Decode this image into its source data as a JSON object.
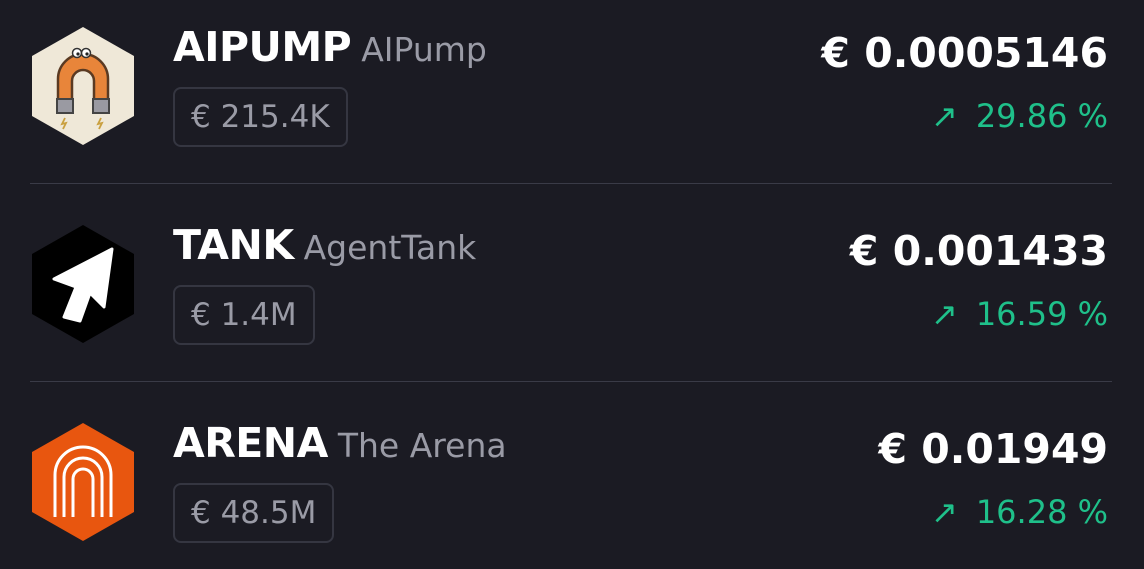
{
  "currency_symbol": "€",
  "colors": {
    "background": "#1b1b23",
    "positive": "#1fc08a",
    "muted_text": "#9a9ba6"
  },
  "tokens": [
    {
      "symbol": "AIPUMP",
      "name": "AIPump",
      "market_cap": "€ 215.4K",
      "price": "€ 0.0005146",
      "change_arrow": "↗",
      "change": "29.86 %",
      "icon": "aipump-magnet-logo-icon"
    },
    {
      "symbol": "TANK",
      "name": "AgentTank",
      "market_cap": "€ 1.4M",
      "price": "€ 0.001433",
      "change_arrow": "↗",
      "change": "16.59 %",
      "icon": "agenttank-cursor-logo-icon"
    },
    {
      "symbol": "ARENA",
      "name": "The Arena",
      "market_cap": "€ 48.5M",
      "price": "€ 0.01949",
      "change_arrow": "↗",
      "change": "16.28 %",
      "icon": "arena-arch-logo-icon"
    }
  ]
}
